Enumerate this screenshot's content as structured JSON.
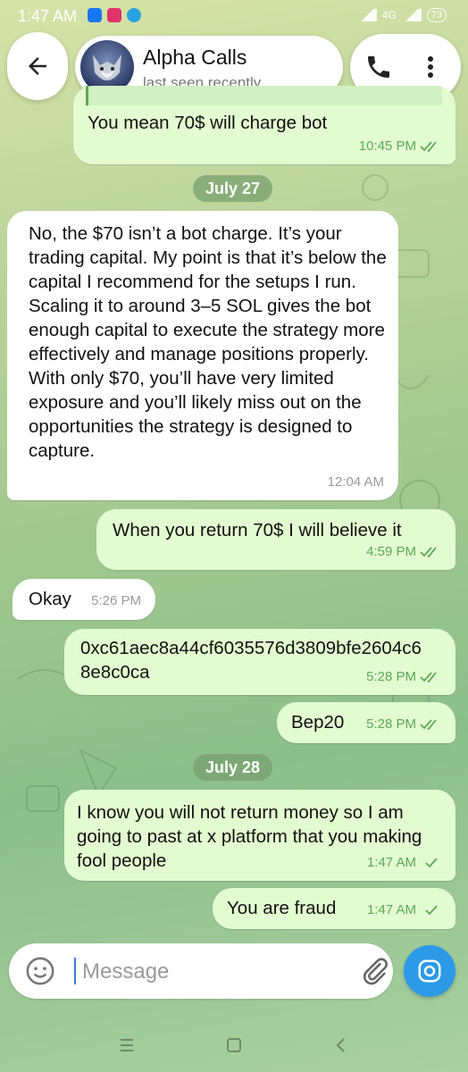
{
  "status_bar": {
    "time": "1:47 AM",
    "network": "4G",
    "battery": "73"
  },
  "header": {
    "title": "Alpha Calls",
    "subtitle": "last seen recently"
  },
  "messages": [
    {
      "text": "You mean 70$ will charge bot",
      "time": "10:45 PM"
    },
    {
      "text": "No, the $70 isn’t a bot charge. It’s your trading capital. My point is that it’s below the capital I recommend for the setups I run. Scaling it to around 3–5 SOL gives the bot enough capital to execute the strategy more effectively and manage positions properly. With only $70, you’ll have very limited exposure and you’ll likely miss out on the opportunities the strategy is designed to capture.",
      "time": "12:04 AM"
    },
    {
      "text": "When you return 70$ I will believe it",
      "time": "4:59 PM"
    },
    {
      "text": "Okay",
      "time": "5:26 PM"
    },
    {
      "text": "0xc61aec8a44cf6035576d3809bfe2604c68e8c0ca",
      "time": "5:28 PM"
    },
    {
      "text": "Bep20",
      "time": "5:28 PM"
    },
    {
      "text": "I know you will not return money so I am going to past at x platform that you making fool people",
      "time": "1:47 AM"
    },
    {
      "text": "You are fraud",
      "time": "1:47 AM"
    }
  ],
  "date_separators": [
    "July 27",
    "July 28"
  ],
  "composer": {
    "placeholder": "Message"
  },
  "icons": {
    "back": "arrow-left-icon",
    "call": "phone-icon",
    "more": "more-vertical-icon",
    "emoji": "emoji-icon",
    "attach": "paperclip-icon",
    "camera": "camera-icon",
    "read": "double-check-icon",
    "sent": "single-check-icon"
  },
  "colors": {
    "outgoing_bubble": "#e3fbd0",
    "incoming_bubble": "#ffffff",
    "accent": "#2d9ae8",
    "check": "#5da75a"
  }
}
